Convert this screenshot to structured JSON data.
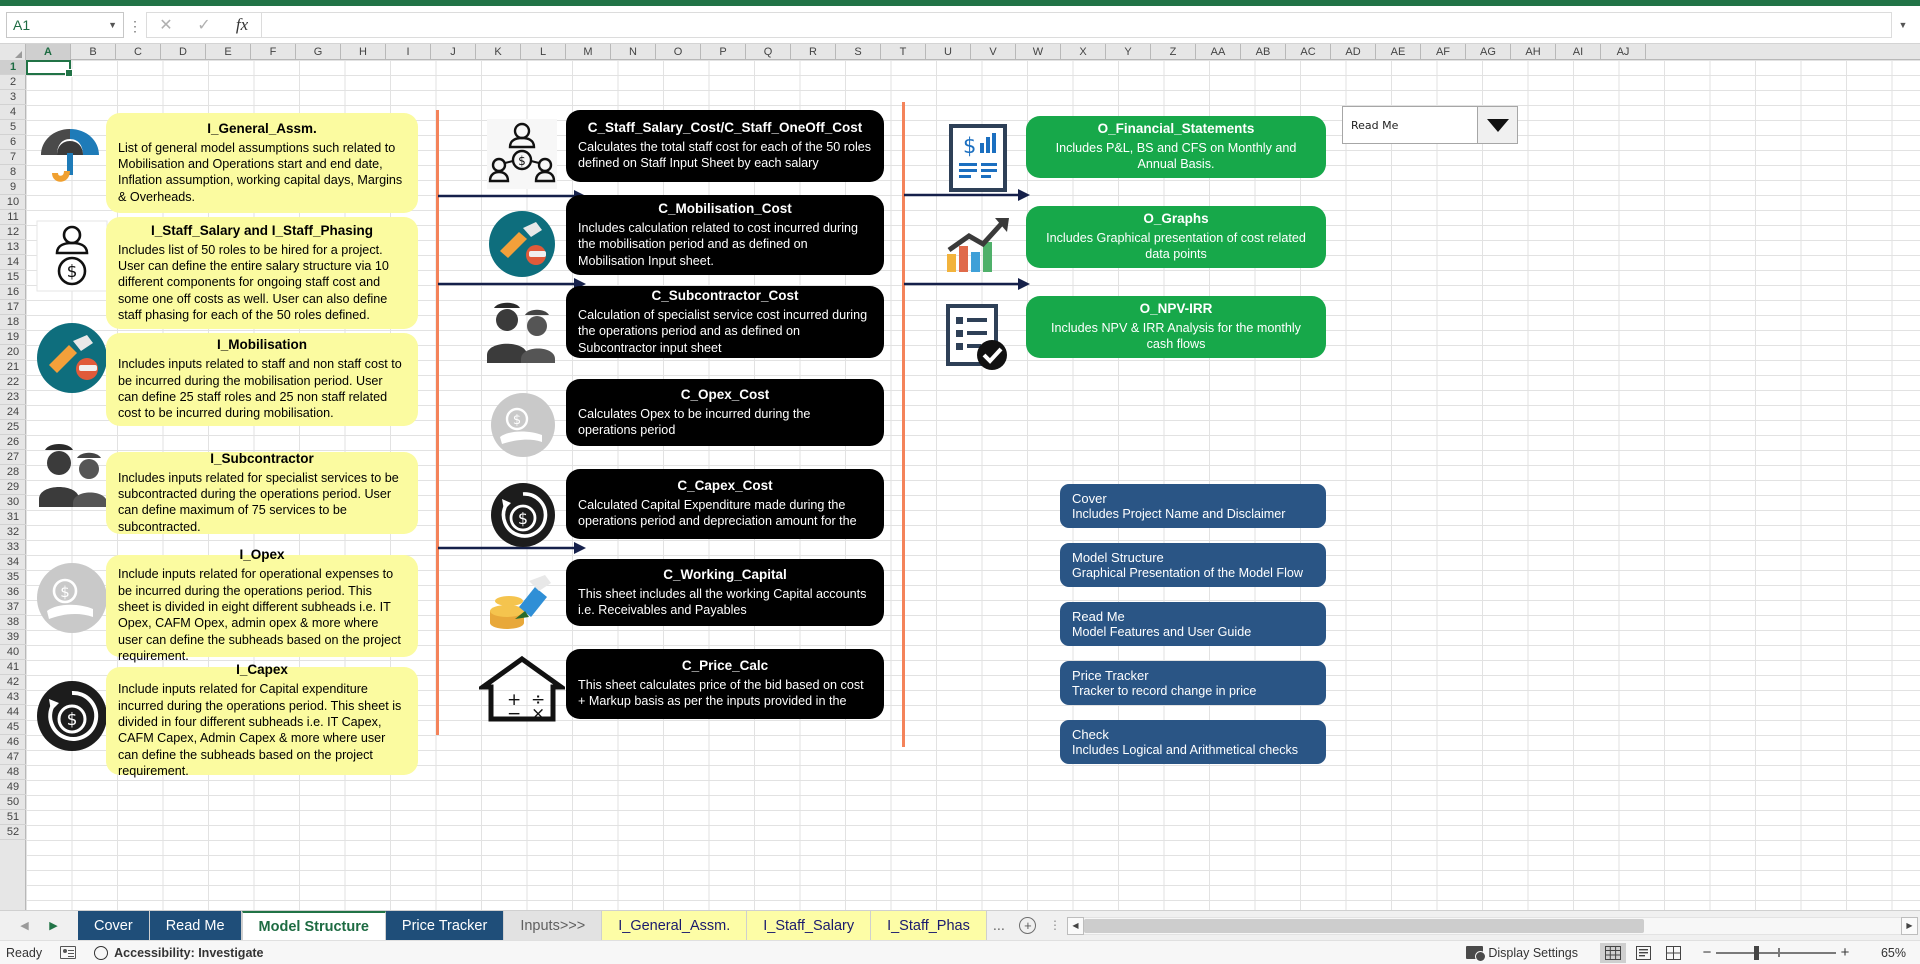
{
  "app": {
    "namebox_value": "A1",
    "formula_value": "",
    "zoom_percent": "65%",
    "status_ready": "Ready",
    "accessibility": "Accessibility: Investigate",
    "display_settings": "Display Settings"
  },
  "combo": {
    "value": "Read Me"
  },
  "columns": [
    "A",
    "B",
    "C",
    "D",
    "E",
    "F",
    "G",
    "H",
    "I",
    "J",
    "K",
    "L",
    "M",
    "N",
    "O",
    "P",
    "Q",
    "R",
    "S",
    "T",
    "U",
    "V",
    "W",
    "X",
    "Y",
    "Z",
    "AA",
    "AB",
    "AC",
    "AD",
    "AE",
    "AF",
    "AG",
    "AH",
    "AI",
    "AJ"
  ],
  "rows": [
    1,
    2,
    3,
    4,
    5,
    6,
    7,
    8,
    9,
    10,
    11,
    12,
    13,
    14,
    15,
    16,
    17,
    18,
    19,
    20,
    21,
    22,
    23,
    24,
    25,
    26,
    27,
    28,
    29,
    30,
    31,
    32,
    33,
    34,
    35,
    36,
    37,
    38,
    39,
    40,
    41,
    42,
    43,
    44,
    45,
    46,
    47,
    48,
    49,
    50,
    51,
    52
  ],
  "colors": {
    "input_yellow": "#FBFBA0",
    "calc_black": "#000000",
    "output_green": "#17A84A",
    "nav_blue": "#2A5585",
    "separator_orange": "#F4835A",
    "arrow_navy": "#15204A",
    "excel_green": "#217346",
    "tab_navy": "#1F4E79",
    "tab_yellow": "#FDFDA6"
  },
  "inputs": [
    {
      "icon": "umbrella-assumptions-icon",
      "title": "I_General_Assm.",
      "body": "List of general model assumptions such related to Mobilisation and Operations start and end date, Inflation assumption, working capital days, Margins & Overheads."
    },
    {
      "icon": "staff-salary-icon",
      "title": "I_Staff_Salary and I_Staff_Phasing",
      "body": "Includes list of 50 roles to be hired for a project. User can define the entire salary structure via 10 different components for ongoing staff cost and some one off costs as well. User can also define staff phasing for each of the 50 roles defined."
    },
    {
      "icon": "mobilisation-tools-icon",
      "title": "I_Mobilisation",
      "body": "Includes inputs related to staff and non staff cost to be incurred during the mobilisation period. User can define 25 staff roles and 25 non staff related cost to be incurred during mobilisation."
    },
    {
      "icon": "subcontractor-workers-icon",
      "title": "I_Subcontractor",
      "body": "Includes inputs related for specialist services to be subcontracted during the operations period. User can define maximum of 75 services to be subcontracted."
    },
    {
      "icon": "opex-hand-coin-icon",
      "title": "I_Opex",
      "body": "Include inputs related for operational expenses to be incurred during the operations period. This sheet is divided in eight different subheads i.e. IT Opex, CAFM Opex, admin opex & more where user can define the subheads based on the project requirement."
    },
    {
      "icon": "capex-cycle-dollar-icon",
      "title": "I_Capex",
      "body": "Include inputs related for Capital expenditure incurred during the operations period. This sheet is divided in four different subheads i.e. IT Capex, CAFM Capex, Admin Capex & more where user can define the subheads based on the project requirement."
    }
  ],
  "calculations": [
    {
      "icon": "staff-network-dollar-icon",
      "title": "C_Staff_Salary_Cost/C_Staff_OneOff_Cost",
      "body": "Calculates the total staff cost for each of the 50 roles defined on Staff Input Sheet by each salary"
    },
    {
      "icon": "mobilisation-tools-icon",
      "title": "C_Mobilisation_Cost",
      "body": "Includes calculation related to cost incurred during the mobilisation period and as defined on Mobilisation Input sheet."
    },
    {
      "icon": "subcontractor-workers-icon",
      "title": "C_Subcontractor_Cost",
      "body": "Calculation of specialist service cost incurred during the operations period and as defined on Subcontractor input sheet"
    },
    {
      "icon": "opex-hand-coin-icon",
      "title": "C_Opex_Cost",
      "body": "Calculates Opex to be incurred during the operations period"
    },
    {
      "icon": "capex-cycle-dollar-icon",
      "title": "C_Capex_Cost",
      "body": "Calculated Capital Expenditure made during the operations period and depreciation amount for the"
    },
    {
      "icon": "working-capital-coins-icon",
      "title": "C_Working_Capital",
      "body": "This sheet includes all the working Capital accounts i.e. Receivables and Payables"
    },
    {
      "icon": "price-calc-house-icon",
      "title": "C_Price_Calc",
      "body": "This sheet calculates price of the bid based on cost + Markup basis as per the inputs provided in the"
    }
  ],
  "outputs": [
    {
      "icon": "financial-statement-icon",
      "title": "O_Financial_Statements",
      "body": "Includes P&L, BS and CFS on Monthly and Annual Basis."
    },
    {
      "icon": "growth-chart-icon",
      "title": "O_Graphs",
      "body": "Includes Graphical presentation of cost related data points"
    },
    {
      "icon": "npv-irr-checklist-icon",
      "title": "O_NPV-IRR",
      "body": "Includes NPV & IRR  Analysis for the monthly cash flows"
    }
  ],
  "navigation": [
    {
      "title": "Cover",
      "subtitle": "Includes Project Name and Disclaimer"
    },
    {
      "title": "Model Structure",
      "subtitle": "Graphical Presentation of the Model Flow"
    },
    {
      "title": "Read Me",
      "subtitle": "Model Features and User Guide"
    },
    {
      "title": "Price Tracker",
      "subtitle": "Tracker to record change in price"
    },
    {
      "title": "Check",
      "subtitle": "Includes Logical and Arithmetical checks"
    }
  ],
  "sheet_tabs": [
    {
      "label": "Cover",
      "style": "navy",
      "active": false
    },
    {
      "label": "Read Me",
      "style": "navy",
      "active": false
    },
    {
      "label": "Model Structure",
      "style": "active",
      "active": true
    },
    {
      "label": "Price Tracker",
      "style": "navy",
      "active": false
    },
    {
      "label": "Inputs>>>",
      "style": "gray",
      "active": false
    },
    {
      "label": "I_General_Assm.",
      "style": "yellow",
      "active": false
    },
    {
      "label": "I_Staff_Salary",
      "style": "yellow",
      "active": false
    },
    {
      "label": "I_Staff_Phas",
      "style": "yellow",
      "active": false
    },
    {
      "label": "...",
      "style": "ellipsis",
      "active": false
    }
  ]
}
